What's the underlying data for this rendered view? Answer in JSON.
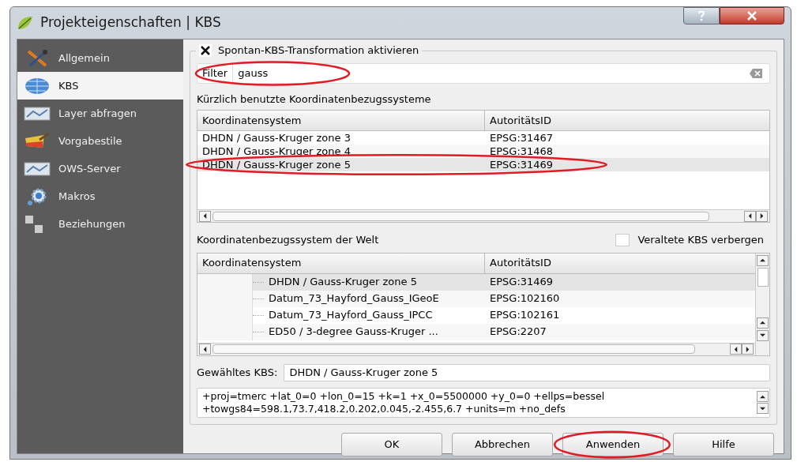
{
  "window": {
    "title": "Projekteigenschaften | KBS"
  },
  "sidebar": {
    "items": [
      {
        "label": "Allgemein",
        "selected": false
      },
      {
        "label": "KBS",
        "selected": true
      },
      {
        "label": "Layer abfragen",
        "selected": false
      },
      {
        "label": "Vorgabestile",
        "selected": false
      },
      {
        "label": "OWS-Server",
        "selected": false
      },
      {
        "label": "Makros",
        "selected": false
      },
      {
        "label": "Beziehungen",
        "selected": false
      }
    ]
  },
  "transformation": {
    "label": "Spontan-KBS-Transformation aktivieren",
    "checked": true
  },
  "filter": {
    "label": "Filter",
    "value": "gauss",
    "highlighted": true
  },
  "recent": {
    "title": "Kürzlich benutzte Koordinatenbezugssysteme",
    "columns": [
      "Koordinatensystem",
      "AutoritätsID"
    ],
    "rows": [
      {
        "cells": [
          "DHDN / Gauss-Kruger zone 3",
          "EPSG:31467"
        ],
        "selected": false,
        "highlighted": false
      },
      {
        "cells": [
          "DHDN / Gauss-Kruger zone 4",
          "EPSG:31468"
        ],
        "selected": false,
        "highlighted": false
      },
      {
        "cells": [
          "DHDN / Gauss-Kruger zone 5",
          "EPSG:31469"
        ],
        "selected": true,
        "highlighted": true
      }
    ]
  },
  "world": {
    "title": "Koordinatenbezugssystem der Welt",
    "hide_deprecated": {
      "label": "Veraltete KBS verbergen",
      "checked": false
    },
    "columns": [
      "Koordinatensystem",
      "AutoritätsID"
    ],
    "rows": [
      {
        "cells": [
          "DHDN / Gauss-Kruger zone 5",
          "EPSG:31469"
        ],
        "selected": true
      },
      {
        "cells": [
          "Datum_73_Hayford_Gauss_IGeoE",
          "EPSG:102160"
        ],
        "selected": false
      },
      {
        "cells": [
          "Datum_73_Hayford_Gauss_IPCC",
          "EPSG:102161"
        ],
        "selected": false
      },
      {
        "cells": [
          "ED50 / 3-degree Gauss-Kruger ...",
          "EPSG:2207"
        ],
        "selected": false
      }
    ]
  },
  "selected_crs": {
    "label": "Gewähltes KBS:",
    "value": "DHDN / Gauss-Kruger zone 5"
  },
  "proj_string": [
    "+proj=tmerc +lat_0=0 +lon_0=15 +k=1 +x_0=5500000 +y_0=0 +ellps=bessel",
    "+towgs84=598.1,73.7,418.2,0.202,0.045,-2.455,6.7 +units=m +no_defs"
  ],
  "buttons": [
    {
      "label": "OK",
      "highlighted": false
    },
    {
      "label": "Abbrechen",
      "highlighted": false
    },
    {
      "label": "Anwenden",
      "highlighted": true
    },
    {
      "label": "Hilfe",
      "highlighted": false
    }
  ]
}
